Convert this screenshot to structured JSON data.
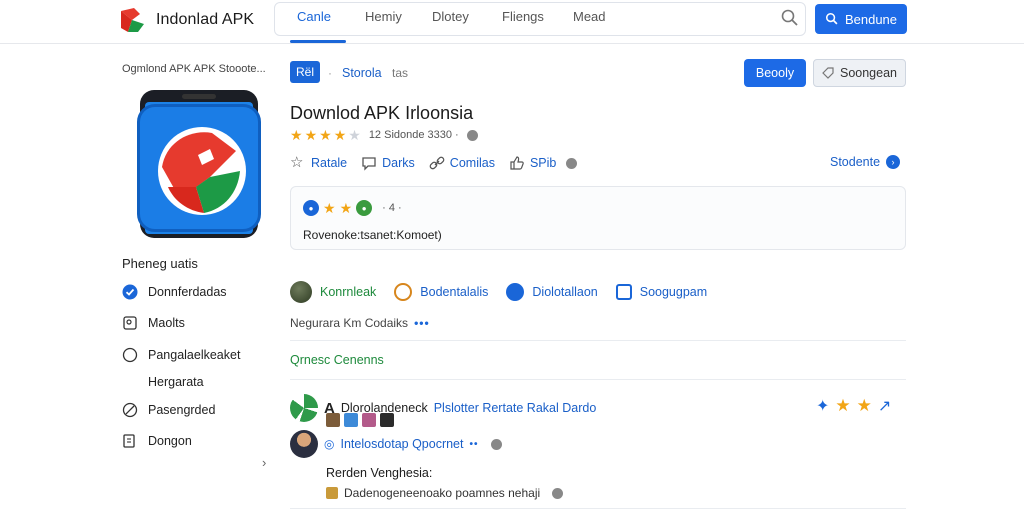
{
  "header": {
    "logo_text": "Indonlad APK",
    "tabs": [
      {
        "label": "Canle",
        "active": true
      },
      {
        "label": "Hemiy",
        "active": false
      },
      {
        "label": "Dlotey",
        "active": false
      },
      {
        "label": "Fliengs",
        "active": false
      },
      {
        "label": "Mead",
        "active": false
      }
    ],
    "action_label": "Bendune",
    "accent": "#1d6ae6"
  },
  "sidebar": {
    "title": "Ogmlond APK  APK Stooote...",
    "section_label": "Pheneg uatis",
    "items": [
      {
        "label": "Donnferdadas",
        "icon": "check-circle-icon"
      },
      {
        "label": "Maolts",
        "icon": "image-icon"
      },
      {
        "label": "Pangalaelkeaket",
        "icon": "circle-icon"
      },
      {
        "label": "Pasengrded",
        "icon": "brush-icon"
      },
      {
        "label": "Dongon",
        "icon": "book-icon"
      }
    ],
    "sub_item": "Hergarata",
    "chevron": "›"
  },
  "main": {
    "tag": "Rël",
    "breadcrumb": [
      "Storola",
      "tas"
    ],
    "primary_button": "Beooly",
    "secondary_button": "Soongean",
    "title": "Downlod APK Irloonsia",
    "rating": {
      "stars": 4,
      "max": 5,
      "meta": "12 Sidonde 3330 ·"
    },
    "actions": [
      {
        "label": "Ratale",
        "icon": "star-outline-icon"
      },
      {
        "label": "Darks",
        "icon": "chat-icon"
      },
      {
        "label": "Comilas",
        "icon": "link-icon"
      },
      {
        "label": "SPib",
        "icon": "thumbs-up-icon"
      }
    ],
    "actions_right": "Stodente",
    "review": {
      "badges_label": "· 4 ·",
      "text": "Rovenoke:tsanet:Komoet)"
    },
    "features": [
      {
        "label": "Konrnleak",
        "color": "green"
      },
      {
        "label": "Bodentalalis",
        "color": "blue"
      },
      {
        "label": "Diolotallaon",
        "color": "blue"
      },
      {
        "label": "Soogugpam",
        "color": "blue"
      }
    ],
    "subline": "Negurara  Km Codaiks",
    "section_head": "Qrnesc  Cenenns",
    "list": [
      {
        "name": "Dlorolandeneck",
        "link": "Plslotter Rertate Rakal Dardo"
      },
      {
        "name": "Intelosdotap  Qpocrnet",
        "link": ""
      }
    ],
    "subhead": "Rerden Venghesia:",
    "last_line": "Dadenogeneenoako poamnes nehaji"
  }
}
